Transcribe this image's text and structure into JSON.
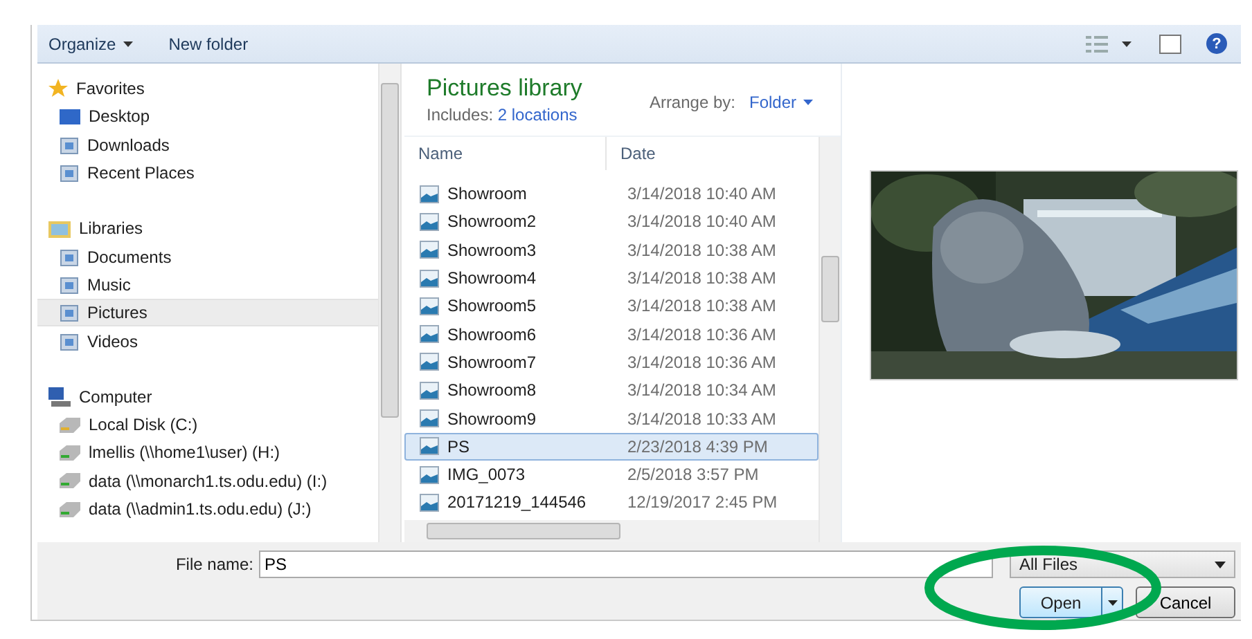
{
  "toolbar": {
    "organize": "Organize",
    "new_folder": "New folder",
    "help": "?"
  },
  "nav": [
    {
      "label": "Favorites",
      "selected": false,
      "children": [
        {
          "label": "Desktop",
          "selected": false
        },
        {
          "label": "Downloads",
          "selected": false
        },
        {
          "label": "Recent Places",
          "selected": false
        }
      ]
    },
    {
      "label": "Libraries",
      "selected": false,
      "children": [
        {
          "label": "Documents",
          "selected": false
        },
        {
          "label": "Music",
          "selected": false
        },
        {
          "label": "Pictures",
          "selected": true
        },
        {
          "label": "Videos",
          "selected": false
        }
      ]
    },
    {
      "label": "Computer",
      "selected": false,
      "children": [
        {
          "label": "Local Disk (C:)",
          "selected": false
        },
        {
          "label": "lmellis (\\\\home1\\user) (H:)",
          "selected": false
        },
        {
          "label": "data (\\\\monarch1.ts.odu.edu) (I:)",
          "selected": false
        },
        {
          "label": "data (\\\\admin1.ts.odu.edu) (J:)",
          "selected": false
        }
      ]
    }
  ],
  "library": {
    "title": "Pictures library",
    "includes_label": "Includes:",
    "includes_link": "2 locations",
    "arrange_label": "Arrange by:",
    "arrange_value": "Folder"
  },
  "columns": [
    "Name",
    "Date"
  ],
  "files": [
    {
      "name": "Showroom",
      "date": "3/14/2018 10:40 AM",
      "selected": false
    },
    {
      "name": "Showroom2",
      "date": "3/14/2018 10:40 AM",
      "selected": false
    },
    {
      "name": "Showroom3",
      "date": "3/14/2018 10:38 AM",
      "selected": false
    },
    {
      "name": "Showroom4",
      "date": "3/14/2018 10:38 AM",
      "selected": false
    },
    {
      "name": "Showroom5",
      "date": "3/14/2018 10:38 AM",
      "selected": false
    },
    {
      "name": "Showroom6",
      "date": "3/14/2018 10:36 AM",
      "selected": false
    },
    {
      "name": "Showroom7",
      "date": "3/14/2018 10:36 AM",
      "selected": false
    },
    {
      "name": "Showroom8",
      "date": "3/14/2018 10:34 AM",
      "selected": false
    },
    {
      "name": "Showroom9",
      "date": "3/14/2018 10:33 AM",
      "selected": false
    },
    {
      "name": "PS",
      "date": "2/23/2018 4:39 PM",
      "selected": true
    },
    {
      "name": "IMG_0073",
      "date": "2/5/2018 3:57 PM",
      "selected": false
    },
    {
      "name": "20171219_144546",
      "date": "12/19/2017 2:45 PM",
      "selected": false
    }
  ],
  "preview": {
    "kind": "picture"
  },
  "footer": {
    "file_name_label": "File name:",
    "file_name_value": "PS",
    "file_type": "All Files",
    "open": "Open",
    "cancel": "Cancel"
  }
}
